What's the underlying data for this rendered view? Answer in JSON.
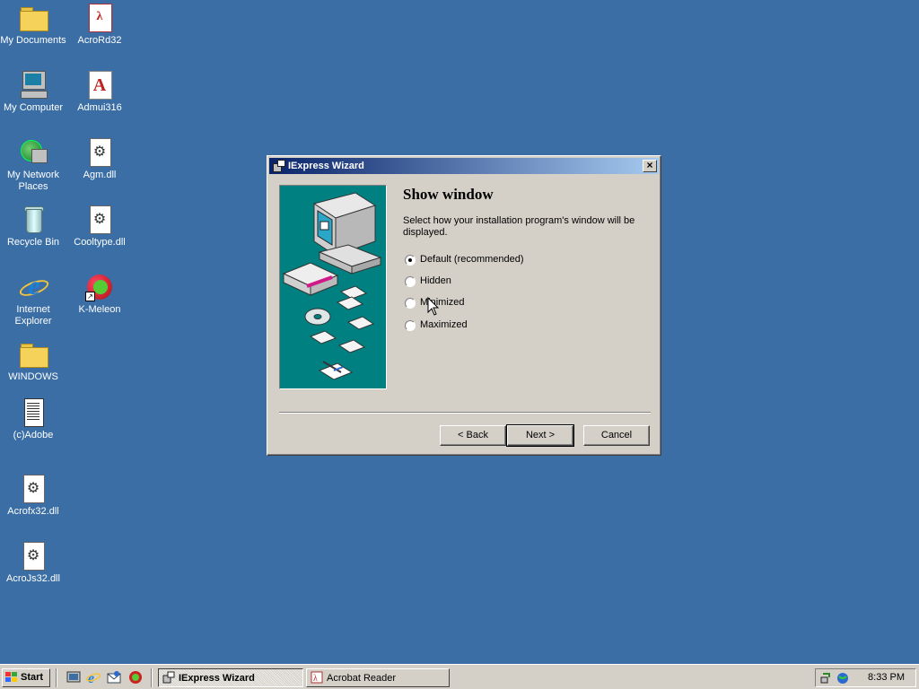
{
  "desktop": {
    "icons": [
      {
        "label": "My Documents",
        "icon": "folder-icon"
      },
      {
        "label": "My Computer",
        "icon": "my-computer-icon"
      },
      {
        "label": "My Network Places",
        "icon": "network-places-icon"
      },
      {
        "label": "Recycle Bin",
        "icon": "recycle-bin-icon"
      },
      {
        "label": "Internet Explorer",
        "icon": "internet-explorer-icon"
      },
      {
        "label": "WINDOWS",
        "icon": "folder-icon"
      },
      {
        "label": "(c)Adobe",
        "icon": "text-file-icon"
      },
      {
        "label": "Acrofx32.dll",
        "icon": "dll-file-icon"
      },
      {
        "label": "AcroJs32.dll",
        "icon": "dll-file-icon"
      },
      {
        "label": "AcroRd32",
        "icon": "pdf-app-icon"
      },
      {
        "label": "Admui316",
        "icon": "adobe-document-icon"
      },
      {
        "label": "Agm.dll",
        "icon": "dll-file-icon"
      },
      {
        "label": "Cooltype.dll",
        "icon": "dll-file-icon"
      },
      {
        "label": "K-Meleon",
        "icon": "k-meleon-icon"
      }
    ]
  },
  "dialog": {
    "title": "IExpress Wizard",
    "heading": "Show window",
    "description": "Select how your installation program's window will be displayed.",
    "options": [
      {
        "label": "Default (recommended)",
        "selected": true
      },
      {
        "label": "Hidden",
        "selected": false
      },
      {
        "label": "Minimized",
        "selected": false
      },
      {
        "label": "Maximized",
        "selected": false
      }
    ],
    "buttons": {
      "back": "< Back",
      "next": "Next >",
      "cancel": "Cancel"
    }
  },
  "taskbar": {
    "start_label": "Start",
    "tasks": [
      {
        "label": "IExpress Wizard",
        "active": true
      },
      {
        "label": "Acrobat Reader",
        "active": false
      }
    ],
    "clock": "8:33 PM"
  },
  "colors": {
    "desktop": "#3a6ea5",
    "titlebar_start": "#0a246a",
    "titlebar_end": "#a6caf0",
    "face": "#d4d0c8",
    "wizard_panel": "#008080"
  }
}
